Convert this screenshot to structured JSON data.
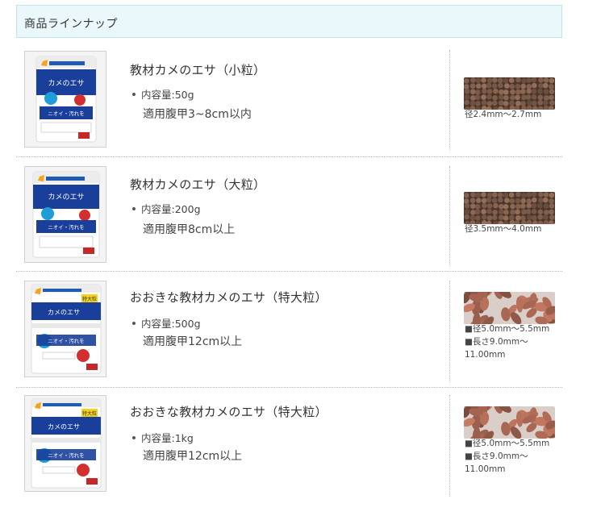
{
  "header": {
    "title": "商品ラインナップ"
  },
  "products": [
    {
      "name": "教材カメのエサ（小粒）",
      "capacity": "内容量:50g",
      "usage": "適用腹甲3~8cm以内",
      "pellet_lines": [
        "径2.4mm～2.7mm"
      ],
      "pellet_color": "#7a5a48"
    },
    {
      "name": "教材カメのエサ（大粒）",
      "capacity": "内容量:200g",
      "usage": "適用腹甲8cm以上",
      "pellet_lines": [
        "径3.5mm～4.0mm"
      ],
      "pellet_color": "#7a5a48"
    },
    {
      "name": "おおきな教材カメのエサ（特大粒）",
      "capacity": "内容量:500g",
      "usage": "適用腹甲12cm以上",
      "pellet_lines": [
        "■径5.0mm～5.5mm",
        "■長さ9.0mm～",
        "11.00mm"
      ],
      "pellet_color": "#9a5e4c"
    },
    {
      "name": "おおきな教材カメのエサ（特大粒）",
      "capacity": "内容量:1kg",
      "usage": "適用腹甲12cm以上",
      "pellet_lines": [
        "■径5.0mm～5.5mm",
        "■長さ9.0mm～",
        "11.00mm"
      ],
      "pellet_color": "#9a5e4c"
    }
  ],
  "package_text": {
    "brand": "Hikari",
    "main_label": "カメのエサ",
    "sub_label": "ニオイ・汚れをおさえる",
    "badge_large": "特大粒"
  }
}
